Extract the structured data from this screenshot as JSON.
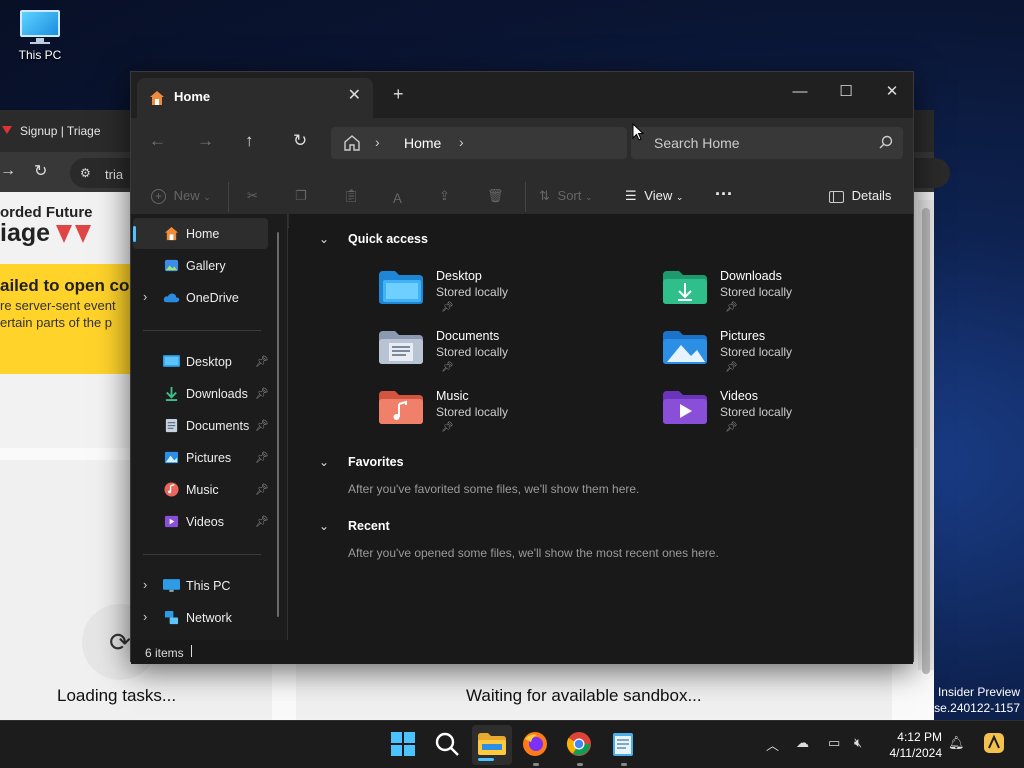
{
  "desktop": {
    "icon_label": "This PC"
  },
  "browser": {
    "tab_title": "Signup | Triage",
    "url_text": "tria",
    "brand_line1": "orded Future",
    "brand_line2": "iage",
    "banner_title": "ailed to open co",
    "banner_line1": "re server-sent event",
    "banner_line2": "ertain parts of the p",
    "loading_text": "Loading tasks...",
    "waiting_text": "Waiting for available sandbox...",
    "insider_line1": "Insider Preview",
    "insider_line2": "ase.240122-1157"
  },
  "explorer": {
    "tab_title": "Home",
    "breadcrumb": "Home",
    "search_placeholder": "Search Home",
    "toolbar": {
      "new_label": "New",
      "sort_label": "Sort",
      "view_label": "View",
      "more_label": "···",
      "details_label": "Details"
    },
    "nav": {
      "home": "Home",
      "gallery": "Gallery",
      "onedrive": "OneDrive",
      "pinned": [
        {
          "label": "Desktop",
          "icon": "desktop-icon"
        },
        {
          "label": "Downloads",
          "icon": "downloads-icon"
        },
        {
          "label": "Documents",
          "icon": "documents-icon"
        },
        {
          "label": "Pictures",
          "icon": "pictures-icon"
        },
        {
          "label": "Music",
          "icon": "music-icon"
        },
        {
          "label": "Videos",
          "icon": "videos-icon"
        }
      ],
      "this_pc": "This PC",
      "network": "Network"
    },
    "sections": {
      "quick_access": "Quick access",
      "favorites": "Favorites",
      "favorites_empty": "After you've favorited some files, we'll show them here.",
      "recent": "Recent",
      "recent_empty": "After you've opened some files, we'll show the most recent ones here."
    },
    "quick_access_items": [
      {
        "name": "Desktop",
        "status": "Stored locally"
      },
      {
        "name": "Downloads",
        "status": "Stored locally"
      },
      {
        "name": "Documents",
        "status": "Stored locally"
      },
      {
        "name": "Pictures",
        "status": "Stored locally"
      },
      {
        "name": "Music",
        "status": "Stored locally"
      },
      {
        "name": "Videos",
        "status": "Stored locally"
      }
    ],
    "status_count": "6 items"
  },
  "taskbar": {
    "time": "4:12 PM",
    "date": "4/11/2024"
  },
  "colors": {
    "accent": "#4cc2ff",
    "explorer_bg": "#191919",
    "toolbar_bg": "#2c2c2c"
  }
}
